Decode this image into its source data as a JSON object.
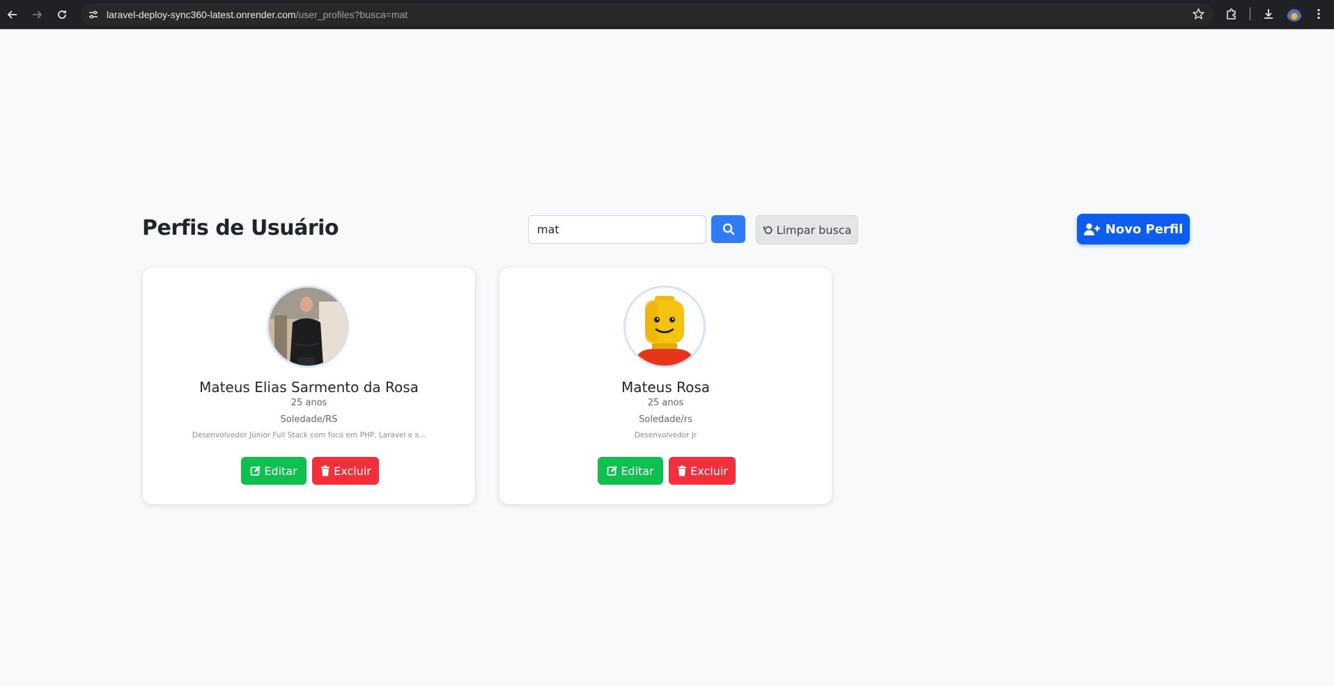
{
  "browser": {
    "url_host": "laravel-deploy-sync360-latest.onrender.com",
    "url_path": "/user_profiles?busca=mat"
  },
  "header": {
    "title": "Perfis de Usuário",
    "search_value": "mat",
    "clear_label": "Limpar busca",
    "new_label": "Novo Perfil"
  },
  "profiles": [
    {
      "name": "Mateus Elias Sarmento da Rosa",
      "age": "25 anos",
      "city": "Soledade/RS",
      "bio": "Desenvolvedor Júnior Full Stack com foco em PHP, Laravel e s...",
      "edit_label": "Editar",
      "delete_label": "Excluir"
    },
    {
      "name": "Mateus Rosa",
      "age": "25 anos",
      "city": "Soledade/rs",
      "bio": "Desenvolvedor Jr",
      "edit_label": "Editar",
      "delete_label": "Excluir"
    }
  ],
  "colors": {
    "primary": "#0d5ef0",
    "search": "#2f7cf6",
    "success": "#0fbf4f",
    "danger": "#f2303b"
  }
}
